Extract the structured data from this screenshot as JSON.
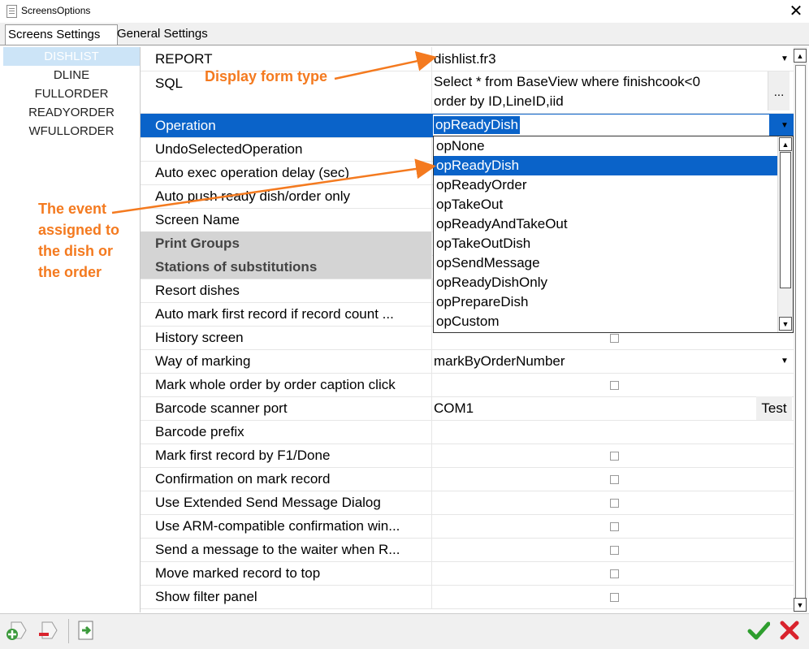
{
  "window": {
    "title": "ScreensOptions",
    "close_glyph": "✕"
  },
  "tabs": [
    {
      "label": "Screens Settings"
    },
    {
      "label": "General Settings"
    }
  ],
  "screens": [
    "DISHLIST",
    "DLINE",
    "FULLORDER",
    "READYORDER",
    "WFULLORDER"
  ],
  "properties": [
    {
      "label": "REPORT",
      "value": "dishlist.fr3"
    },
    {
      "label": "SQL",
      "value_line1": "Select * from BaseView where finishcook<0",
      "value_line2": "order by ID,LineID,iid",
      "button": "..."
    },
    {
      "label": "Operation",
      "value": "opReadyDish"
    },
    {
      "label": "UndoSelectedOperation"
    },
    {
      "label": "Auto exec operation delay (sec)"
    },
    {
      "label": "Auto push ready dish/order only"
    },
    {
      "label": "Screen Name"
    },
    {
      "label": "Print Groups"
    },
    {
      "label": "Stations of substitutions"
    },
    {
      "label": "Resort dishes"
    },
    {
      "label": "Auto mark first record if record count ..."
    },
    {
      "label": "History screen"
    },
    {
      "label": "Way of marking",
      "value": "markByOrderNumber"
    },
    {
      "label": "Mark whole order by order caption click"
    },
    {
      "label": "Barcode scanner port",
      "value": "COM1",
      "button": "Test"
    },
    {
      "label": "Barcode prefix"
    },
    {
      "label": "Mark first record by F1/Done"
    },
    {
      "label": "Confirmation on mark record"
    },
    {
      "label": "Use Extended Send Message Dialog"
    },
    {
      "label": "Use ARM-compatible confirmation win..."
    },
    {
      "label": "Send a message to the waiter when R..."
    },
    {
      "label": "Move marked record to top"
    },
    {
      "label": "Show filter panel"
    }
  ],
  "operation_options": [
    "opNone",
    "opReadyDish",
    "opReadyOrder",
    "opTakeOut",
    "opReadyAndTakeOut",
    "opTakeOutDish",
    "opSendMessage",
    "opReadyDishOnly",
    "opPrepareDish",
    "opCustom"
  ],
  "selected_option": "opReadyDish",
  "annotations": {
    "form_type": "Display form type",
    "event_lines": [
      "The event",
      "assigned to",
      "the dish or",
      "the order"
    ]
  },
  "colors": {
    "accent": "#0a63c9",
    "annotation": "#f47a1f",
    "ok": "#2e9e2e",
    "cancel": "#d9232d"
  }
}
